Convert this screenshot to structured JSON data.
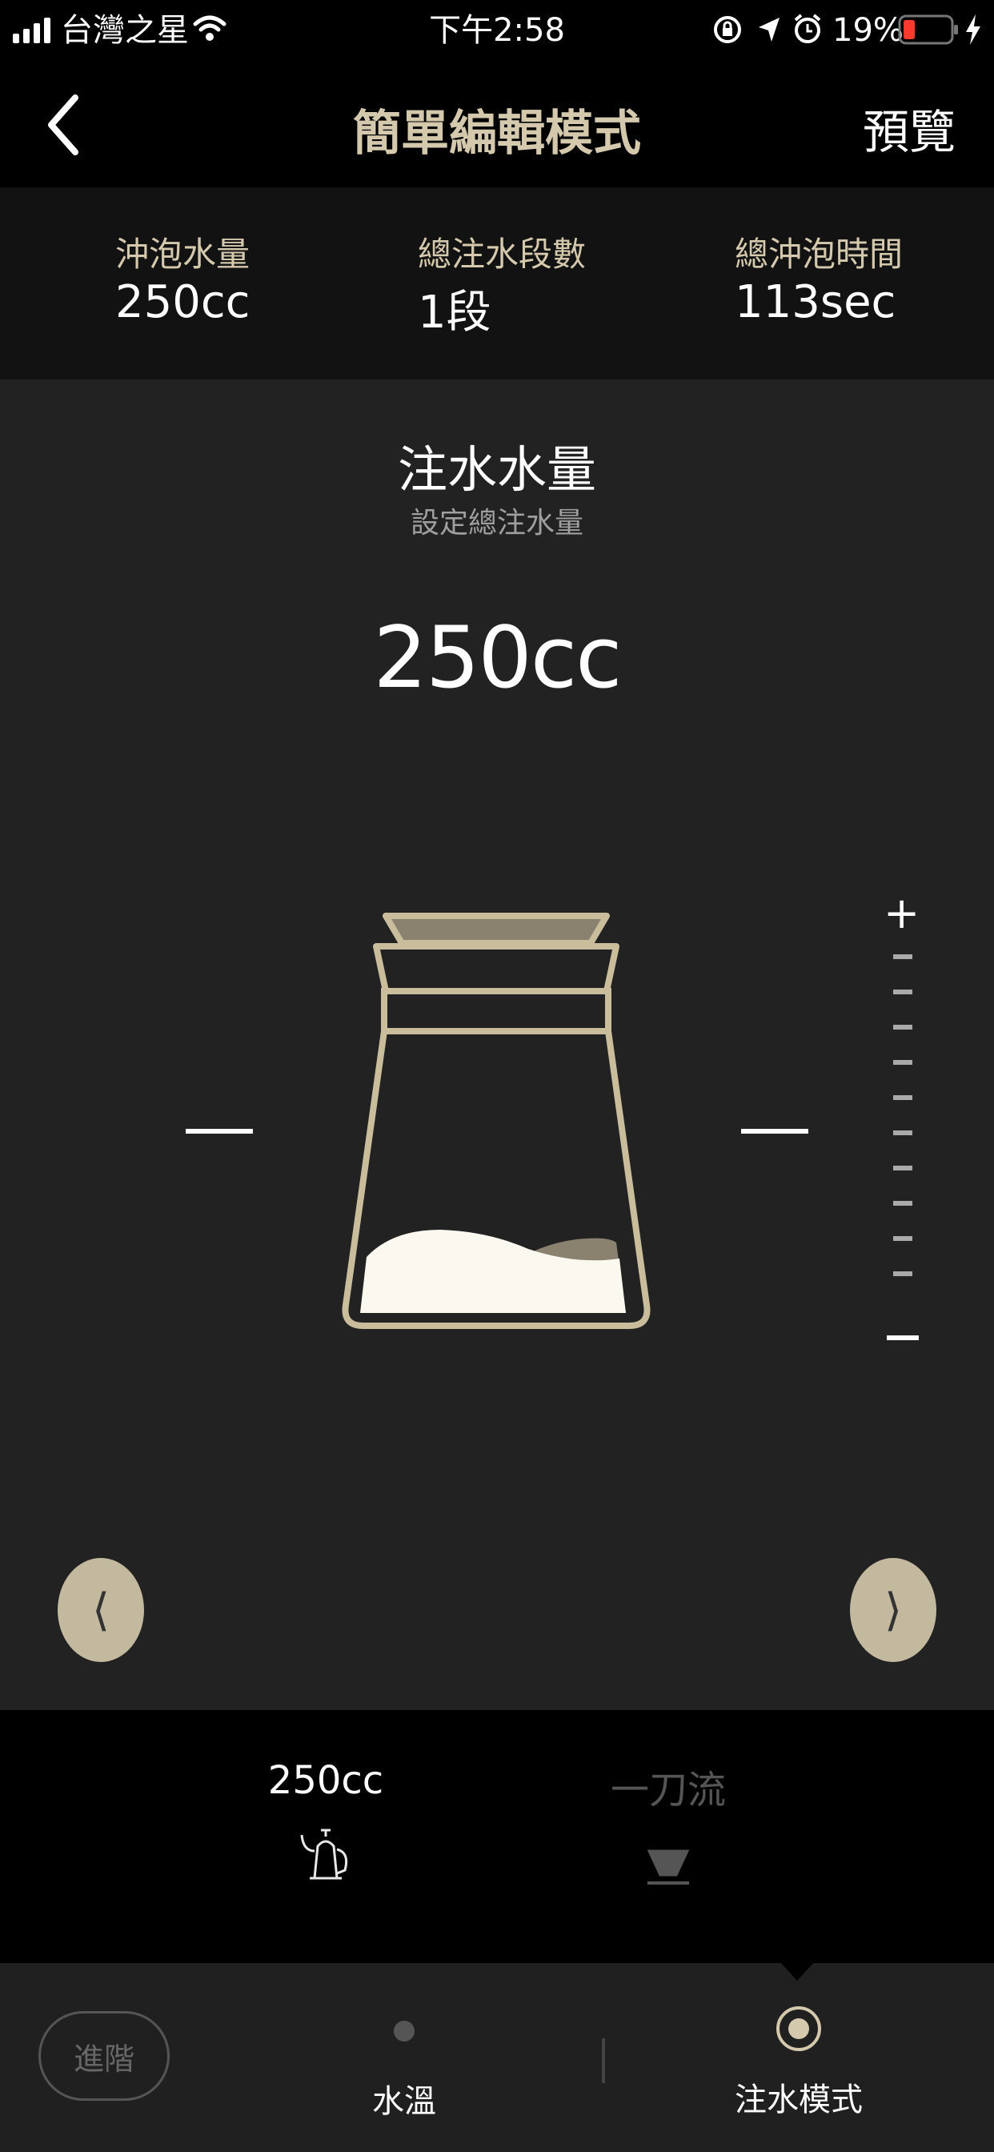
{
  "status_bar": {
    "carrier": "台灣之星",
    "time": "下午2:58",
    "battery": "19%",
    "icons": [
      "signal-icon",
      "wifi-icon",
      "rotation-lock-icon",
      "location-icon",
      "alarm-icon",
      "battery-icon",
      "charging-icon"
    ]
  },
  "nav": {
    "title": "簡單編輯模式",
    "preview": "預覽",
    "back_icon": "chevron-left-icon"
  },
  "summary": {
    "items": [
      {
        "label": "沖泡水量",
        "value": "250cc"
      },
      {
        "label": "總注水段數",
        "value": "1段"
      },
      {
        "label": "總沖泡時間",
        "value": "113sec"
      }
    ]
  },
  "main": {
    "title": "注水水量",
    "subtitle": "設定總注水量",
    "value": "250cc",
    "plus": "+",
    "prev_arrow": "⟨",
    "next_arrow": "⟩",
    "illustration": "coffee-server-icon"
  },
  "selector": {
    "options": [
      {
        "label": "250cc",
        "icon": "kettle-icon",
        "active": true
      },
      {
        "label": "一刀流",
        "icon": "dripper-icon",
        "active": false
      }
    ]
  },
  "tabbar": {
    "advanced": "進階",
    "tabs": [
      {
        "label": "水溫",
        "icon": "dot-icon",
        "active": false
      },
      {
        "label": "注水模式",
        "icon": "target-icon",
        "active": true
      }
    ]
  },
  "colors": {
    "accent": "#d5c9ad",
    "beige_button": "#c3b99e",
    "panel": "#222222",
    "summary_band": "#121212",
    "battery_low": "#ff3b30"
  }
}
